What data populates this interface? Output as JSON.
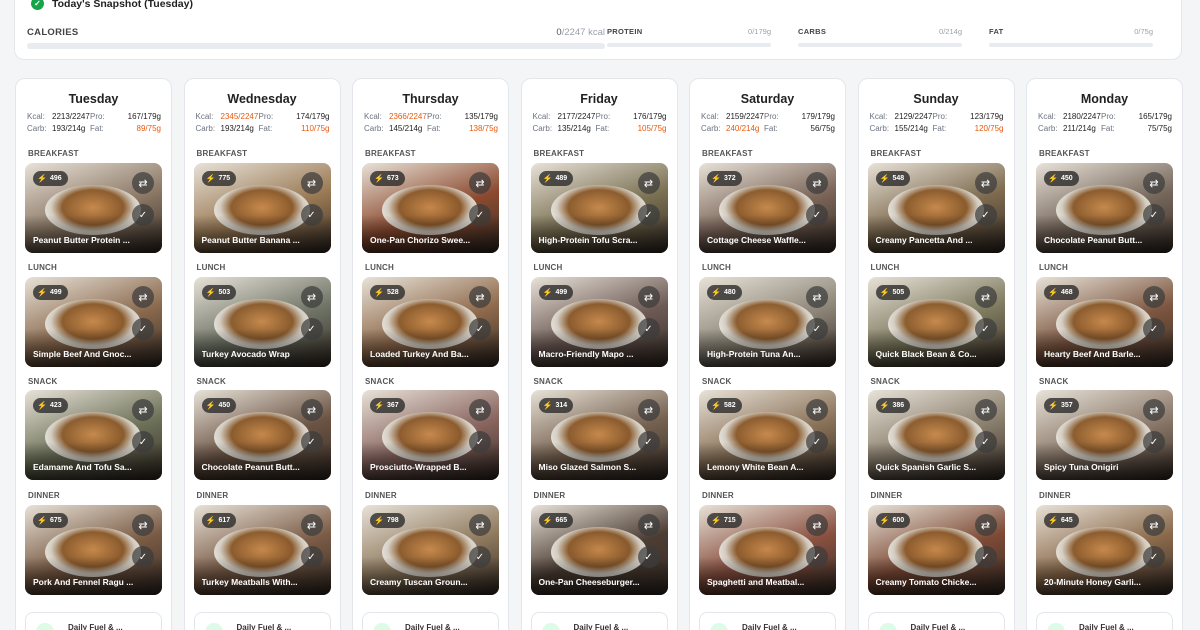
{
  "snapshot": {
    "title": "Today's Snapshot (Tuesday)",
    "calories": {
      "label": "CALORIES",
      "current": "0",
      "target": "/2247 kcal",
      "progress": 0
    },
    "macros": [
      {
        "label": "PROTEIN",
        "value": "0/179g",
        "progress": 0
      },
      {
        "label": "CARBS",
        "value": "0/214g",
        "progress": 0
      },
      {
        "label": "FAT",
        "value": "0/75g",
        "progress": 0
      }
    ]
  },
  "labels": {
    "kcal": "Kcal:",
    "pro": "Pro:",
    "carb": "Carb:",
    "fat": "Fat:",
    "breakfast": "BREAKFAST",
    "lunch": "LUNCH",
    "snack": "SNACK",
    "dinner": "DINNER",
    "fuel": "Daily Fuel & ..."
  },
  "icons": {
    "calorie": "lightning-bolt-icon",
    "swap": "swap-arrows-icon",
    "done": "checkmark-icon",
    "snapshot": "check-circle-icon"
  },
  "colors": {
    "over_target": "#ea580c",
    "success": "#16a34a",
    "bolt": "#facc15"
  },
  "days": [
    {
      "name": "Tuesday",
      "kcal": "2213/2247",
      "pro": "167/179g",
      "carb": "193/214g",
      "fat": "89/75g",
      "kcal_over": false,
      "fat_over": true,
      "meals": [
        {
          "kcal": "496",
          "name": "Peanut Butter Protein ...",
          "color": "#8a7764"
        },
        {
          "kcal": "499",
          "name": "Simple Beef And Gnoc...",
          "color": "#8b6a4e"
        },
        {
          "kcal": "423",
          "name": "Edamame And Tofu Sa...",
          "color": "#6d7158"
        },
        {
          "kcal": "675",
          "name": "Pork And Fennel Ragu ...",
          "color": "#7a5b44"
        }
      ]
    },
    {
      "name": "Wednesday",
      "kcal": "2345/2247",
      "pro": "174/179g",
      "carb": "193/214g",
      "fat": "110/75g",
      "kcal_over": true,
      "fat_over": true,
      "meals": [
        {
          "kcal": "775",
          "name": "Peanut Butter Banana ...",
          "color": "#9a7a55"
        },
        {
          "kcal": "503",
          "name": "Turkey Avocado Wrap",
          "color": "#6f7466"
        },
        {
          "kcal": "450",
          "name": "Chocolate Peanut Butt...",
          "color": "#6b5444"
        },
        {
          "kcal": "617",
          "name": "Turkey Meatballs With...",
          "color": "#7b5c47"
        }
      ]
    },
    {
      "name": "Thursday",
      "kcal": "2366/2247",
      "pro": "135/179g",
      "carb": "145/214g",
      "fat": "138/75g",
      "kcal_over": true,
      "fat_over": true,
      "meals": [
        {
          "kcal": "673",
          "name": "One-Pan Chorizo Swee...",
          "color": "#8c4a2f"
        },
        {
          "kcal": "528",
          "name": "Loaded Turkey And Ba...",
          "color": "#8f6a4c"
        },
        {
          "kcal": "367",
          "name": "Prosciutto-Wrapped B...",
          "color": "#8a6660"
        },
        {
          "kcal": "798",
          "name": "Creamy Tuscan Groun...",
          "color": "#8f7a5e"
        }
      ]
    },
    {
      "name": "Friday",
      "kcal": "2177/2247",
      "pro": "176/179g",
      "carb": "135/214g",
      "fat": "105/75g",
      "kcal_over": false,
      "fat_over": true,
      "meals": [
        {
          "kcal": "489",
          "name": "High-Protein Tofu Scra...",
          "color": "#7a7052"
        },
        {
          "kcal": "499",
          "name": "Macro-Friendly Mapo ...",
          "color": "#6d5a55"
        },
        {
          "kcal": "314",
          "name": "Miso Glazed Salmon S...",
          "color": "#75614f"
        },
        {
          "kcal": "665",
          "name": "One-Pan Cheeseburger...",
          "color": "#4c3d33"
        }
      ]
    },
    {
      "name": "Saturday",
      "kcal": "2159/2247",
      "pro": "179/179g",
      "carb": "240/214g",
      "fat": "56/75g",
      "kcal_over": false,
      "fat_over": false,
      "carb_over": true,
      "meals": [
        {
          "kcal": "372",
          "name": "Cottage Cheese Waffle...",
          "color": "#7b6458"
        },
        {
          "kcal": "480",
          "name": "High-Protein Tuna An...",
          "color": "#8d8678"
        },
        {
          "kcal": "582",
          "name": "Lemony White Bean A...",
          "color": "#8b7359"
        },
        {
          "kcal": "715",
          "name": "Spaghetti and Meatbal...",
          "color": "#8a5040"
        }
      ]
    },
    {
      "name": "Sunday",
      "kcal": "2129/2247",
      "pro": "123/179g",
      "carb": "155/214g",
      "fat": "120/75g",
      "kcal_over": false,
      "fat_over": true,
      "meals": [
        {
          "kcal": "548",
          "name": "Creamy Pancetta And ...",
          "color": "#7d6a4e"
        },
        {
          "kcal": "505",
          "name": "Quick Black Bean & Co...",
          "color": "#7e7a5e"
        },
        {
          "kcal": "386",
          "name": "Quick Spanish Garlic S...",
          "color": "#8a7f6d"
        },
        {
          "kcal": "600",
          "name": "Creamy Tomato Chicke...",
          "color": "#7d4a35"
        }
      ]
    },
    {
      "name": "Monday",
      "kcal": "2180/2247",
      "pro": "165/179g",
      "carb": "211/214g",
      "fat": "75/75g",
      "kcal_over": false,
      "fat_over": false,
      "meals": [
        {
          "kcal": "450",
          "name": "Chocolate Peanut Butt...",
          "color": "#76675b"
        },
        {
          "kcal": "468",
          "name": "Hearty Beef And Barle...",
          "color": "#7d5640"
        },
        {
          "kcal": "357",
          "name": "Spicy Tuna Onigiri",
          "color": "#8a7869"
        },
        {
          "kcal": "645",
          "name": "20-Minute Honey Garli...",
          "color": "#8b6a4b"
        }
      ]
    }
  ]
}
